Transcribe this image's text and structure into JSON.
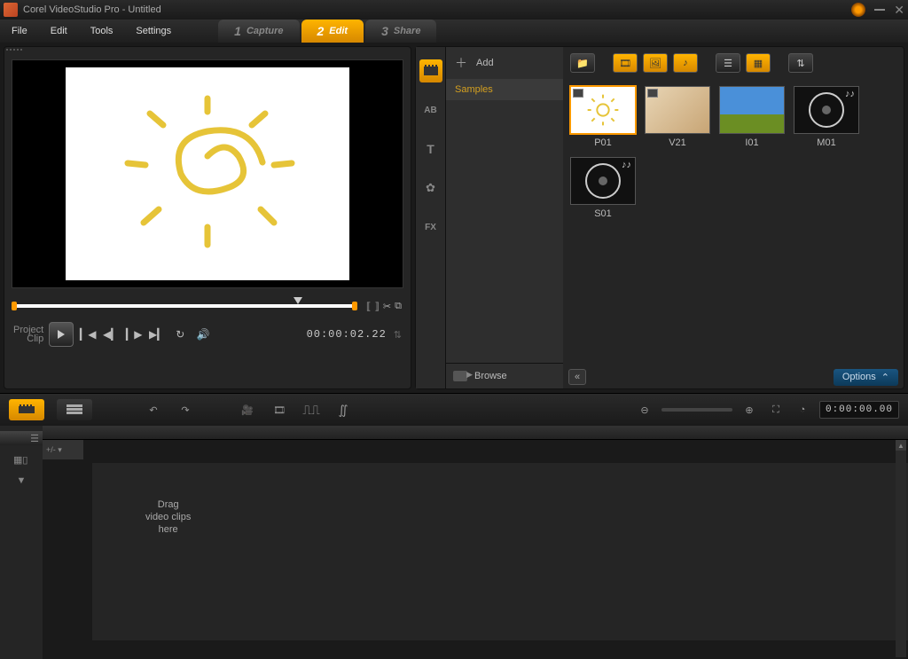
{
  "app": {
    "title": "Corel VideoStudio Pro - Untitled"
  },
  "menu": {
    "file": "File",
    "edit": "Edit",
    "tools": "Tools",
    "settings": "Settings"
  },
  "steps": {
    "s1": {
      "num": "1",
      "label": "Capture"
    },
    "s2": {
      "num": "2",
      "label": "Edit"
    },
    "s3": {
      "num": "3",
      "label": "Share"
    }
  },
  "preview": {
    "project_label": "Project",
    "clip_label": "Clip",
    "timecode": "00:00:02.22"
  },
  "library": {
    "add_label": "Add",
    "folder_samples": "Samples",
    "browse_label": "Browse",
    "options_label": "Options",
    "thumbs": {
      "p01": "P01",
      "v21": "V21",
      "i01": "I01",
      "m01": "M01",
      "s01": "S01"
    }
  },
  "timeline": {
    "timecode": "0:00:00.00",
    "drop_hint": "Drag\nvideo clips\nhere"
  }
}
